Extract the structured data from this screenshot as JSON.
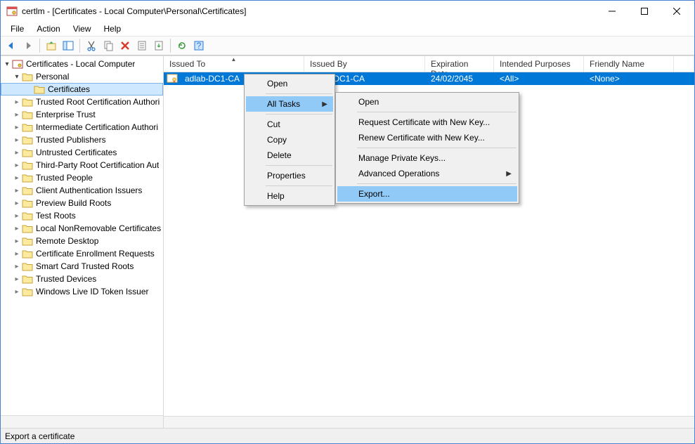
{
  "window": {
    "title": "certlm - [Certificates - Local Computer\\Personal\\Certificates]"
  },
  "menu": {
    "file": "File",
    "action": "Action",
    "view": "View",
    "help": "Help"
  },
  "tree": {
    "root": "Certificates - Local Computer",
    "personal": "Personal",
    "certificates": "Certificates",
    "items": [
      "Trusted Root Certification Authori",
      "Enterprise Trust",
      "Intermediate Certification Authori",
      "Trusted Publishers",
      "Untrusted Certificates",
      "Third-Party Root Certification Aut",
      "Trusted People",
      "Client Authentication Issuers",
      "Preview Build Roots",
      "Test Roots",
      "Local NonRemovable Certificates",
      "Remote Desktop",
      "Certificate Enrollment Requests",
      "Smart Card Trusted Roots",
      "Trusted Devices",
      "Windows Live ID Token Issuer"
    ]
  },
  "list": {
    "headers": {
      "issued_to": "Issued To",
      "issued_by": "Issued By",
      "expiration": "Expiration Date",
      "purposes": "Intended Purposes",
      "friendly": "Friendly Name"
    },
    "row": {
      "issued_to": "adlab-DC1-CA",
      "issued_by": "adlab-DC1-CA",
      "expiration": "24/02/2045",
      "purposes": "<All>",
      "friendly": "<None>"
    }
  },
  "ctx1": {
    "open": "Open",
    "all_tasks": "All Tasks",
    "cut": "Cut",
    "copy": "Copy",
    "delete": "Delete",
    "properties": "Properties",
    "help": "Help"
  },
  "ctx2": {
    "open": "Open",
    "request": "Request Certificate with New Key...",
    "renew": "Renew Certificate with New Key...",
    "manage_keys": "Manage Private Keys...",
    "advanced": "Advanced Operations",
    "export": "Export..."
  },
  "status": {
    "text": "Export a certificate"
  }
}
